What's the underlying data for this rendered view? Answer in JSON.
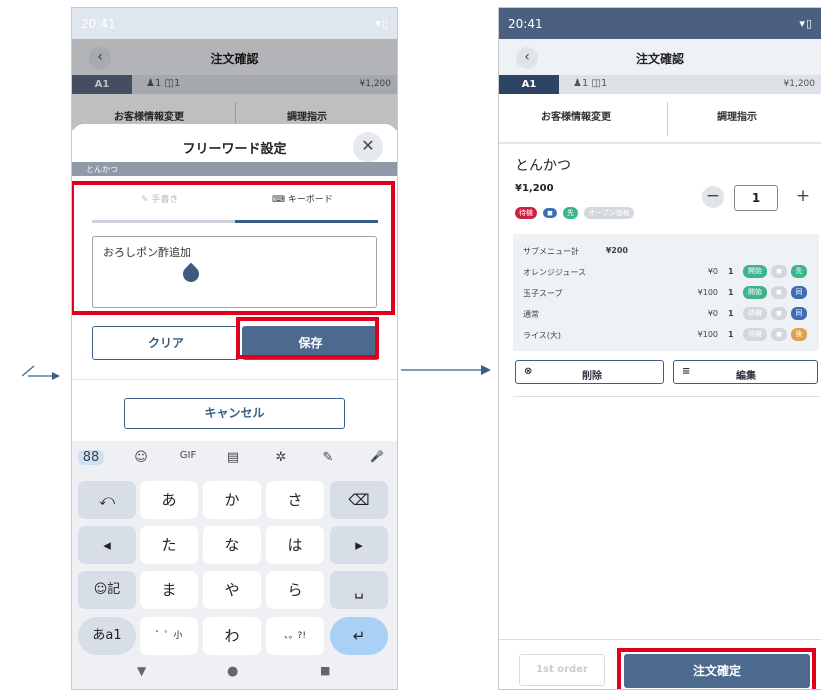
{
  "status": {
    "time": "20:41",
    "icons": "▾▯"
  },
  "header": {
    "back_icon": "‹",
    "title": "注文確認"
  },
  "info": {
    "table": "A1",
    "guests": "♟1 ◫1",
    "amount": "¥1,200"
  },
  "actions": {
    "customer": "お客様情報変更",
    "cooking": "調理指示"
  },
  "dialog": {
    "title": "フリーワード設定",
    "close": "✕",
    "section": "とんかつ",
    "tab_handwriting": "手書き",
    "tab_keyboard": "キーボード",
    "text_value": "おろしポン酢追加",
    "clear": "クリア",
    "save": "保存",
    "cancel": "キャンセル"
  },
  "keyboard": {
    "toolbar": [
      "88",
      "☺",
      "GIF",
      "▤",
      "✲",
      "✎",
      "🎤"
    ],
    "rows": [
      [
        "⤺",
        "あ",
        "か",
        "さ",
        "⌫"
      ],
      [
        "◂",
        "た",
        "な",
        "は",
        "▸"
      ],
      [
        "☺記",
        "ま",
        "や",
        "ら",
        "␣"
      ],
      [
        "あa1",
        "゛゜小",
        "わ",
        "、。?!",
        "↵"
      ]
    ],
    "nav": [
      "▼",
      "●",
      "■"
    ]
  },
  "order": {
    "item": "とんかつ",
    "price": "¥1,200",
    "chips": [
      "待機",
      "◼",
      "先",
      "オープン価格"
    ],
    "qty": "1",
    "minus": "−",
    "plus": "+",
    "subitems": [
      {
        "name": "サブメニュー計",
        "price": "¥200",
        "qty": "",
        "tags": []
      },
      {
        "name": "オレンジジュース",
        "price": "¥0",
        "qty": "1",
        "tags": [
          "開始",
          "◼",
          "先"
        ]
      },
      {
        "name": "玉子スープ",
        "price": "¥100",
        "qty": "1",
        "tags": [
          "開始",
          "◼",
          "同"
        ]
      },
      {
        "name": "通常",
        "price": "¥0",
        "qty": "1",
        "tags": [
          "待機",
          "◼",
          "同"
        ]
      },
      {
        "name": "ライス(大)",
        "price": "¥100",
        "qty": "1",
        "tags": [
          "待機",
          "◼",
          "後"
        ]
      }
    ],
    "delete": "削除",
    "edit": "編集",
    "first_order": "1st order",
    "confirm": "注文確定"
  },
  "colors": {
    "accent": "#3a5f85",
    "highlight": "#e0001b",
    "green": "#3cb48c",
    "blue": "#3d6db5"
  }
}
